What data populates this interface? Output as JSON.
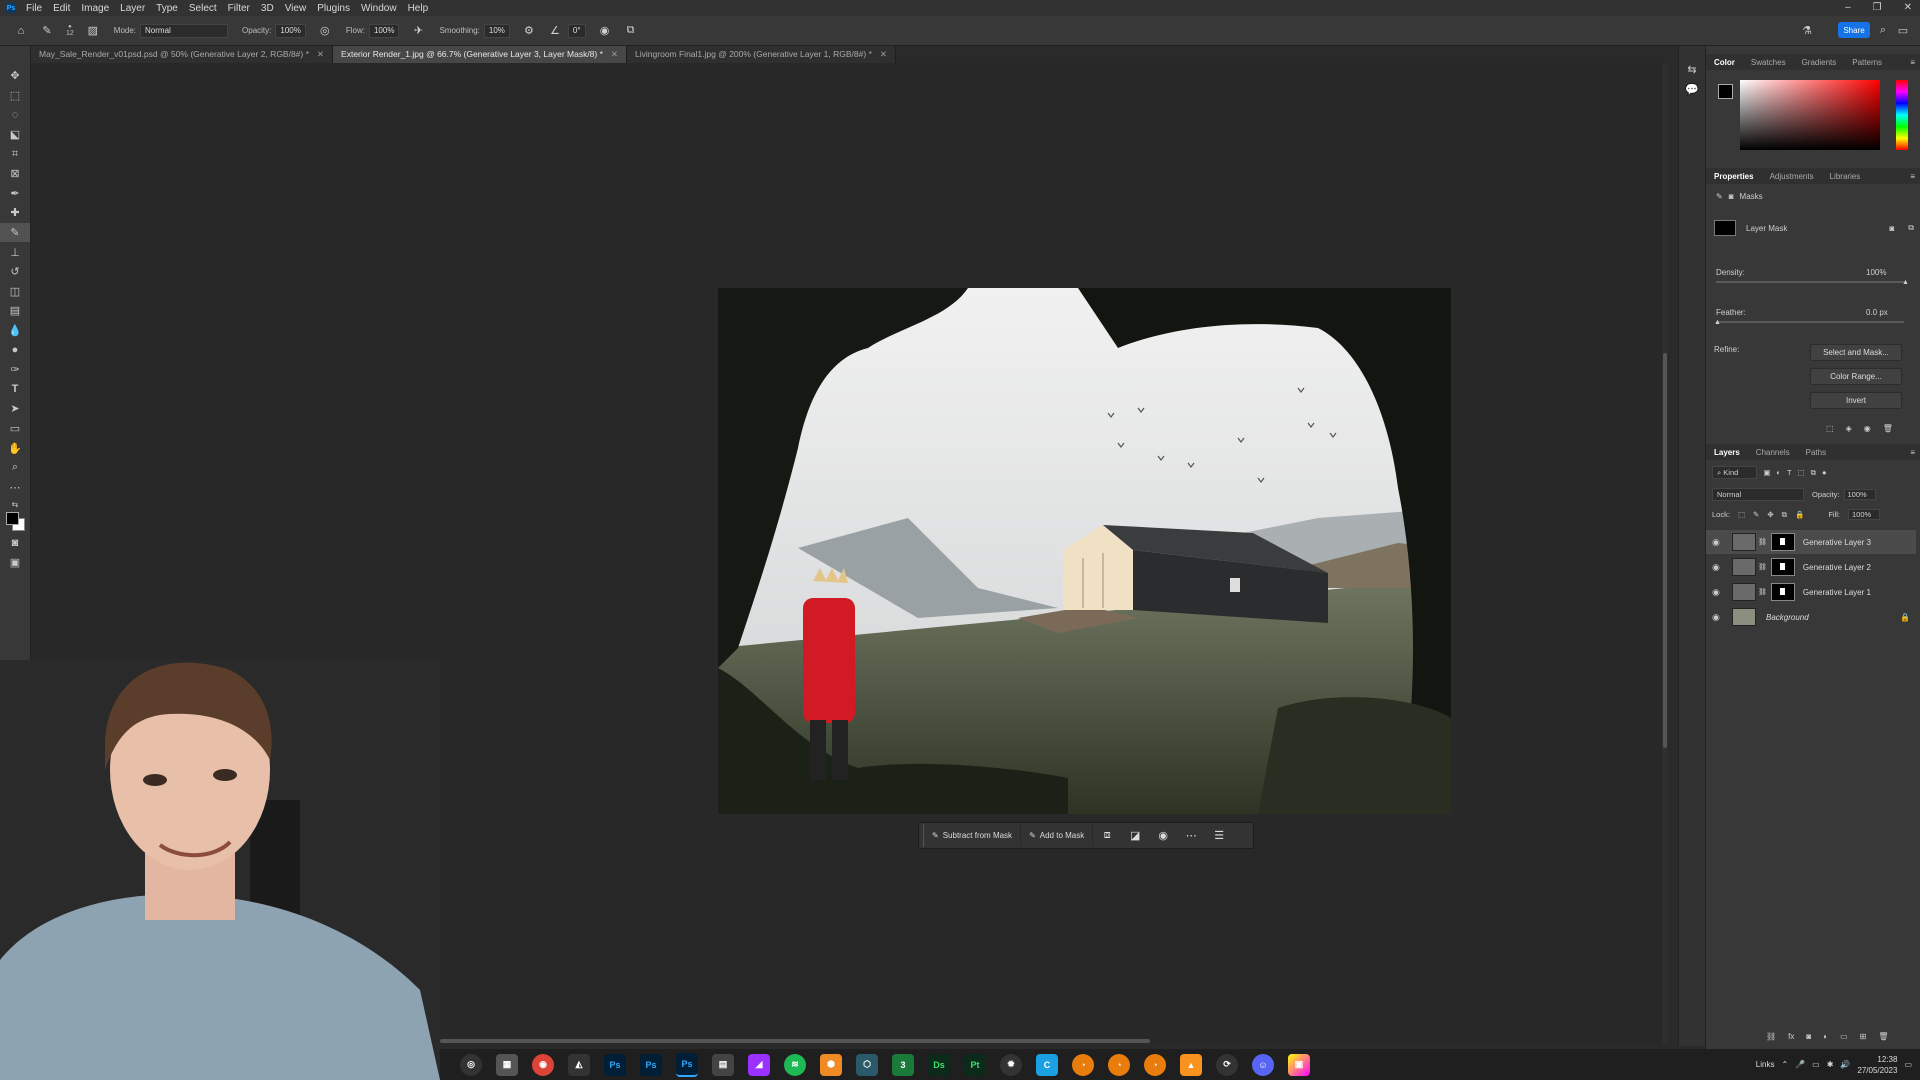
{
  "menubar": {
    "items": [
      "File",
      "Edit",
      "Image",
      "Layer",
      "Type",
      "Select",
      "Filter",
      "3D",
      "View",
      "Plugins",
      "Window",
      "Help"
    ]
  },
  "options": {
    "brush_size": "12",
    "mode_label": "Mode:",
    "mode_value": "Normal",
    "opacity_label": "Opacity:",
    "opacity_value": "100%",
    "flow_label": "Flow:",
    "flow_value": "100%",
    "smoothing_label": "Smoothing:",
    "smoothing_value": "10%",
    "angle_value": "0°",
    "share_label": "Share"
  },
  "tabs": [
    {
      "label": "May_Sale_Render_v01psd.psd @ 50% (Generative Layer 2, RGB/8#) *",
      "active": false
    },
    {
      "label": "Exterior Render_1.jpg @ 66.7% (Generative Layer 3, Layer Mask/8) *",
      "active": true
    },
    {
      "label": "Livingroom Final1.jpg @ 200% (Generative Layer 1, RGB/8#) *",
      "active": false
    }
  ],
  "context_bar": {
    "subtract_label": "Subtract from Mask",
    "add_label": "Add to Mask"
  },
  "color_panel": {
    "tabs": [
      "Color",
      "Swatches",
      "Gradients",
      "Patterns"
    ],
    "foreground": "#000000",
    "background": "#ffffff",
    "hue": "#ff0000"
  },
  "properties": {
    "tabs": [
      "Properties",
      "Adjustments",
      "Libraries"
    ],
    "section_title": "Masks",
    "mask_label": "Layer Mask",
    "density_label": "Density:",
    "density_value": "100%",
    "feather_label": "Feather:",
    "feather_value": "0.0 px",
    "refine_label": "Refine:",
    "select_and_mask": "Select and Mask...",
    "color_range": "Color Range...",
    "invert": "Invert"
  },
  "layers_panel": {
    "tabs": [
      "Layers",
      "Channels",
      "Paths"
    ],
    "kind_label": "Kind",
    "blend_mode": "Normal",
    "opacity_label": "Opacity:",
    "opacity_value": "100%",
    "lock_label": "Lock:",
    "fill_label": "Fill:",
    "fill_value": "100%",
    "layers": [
      {
        "name": "Generative Layer 3",
        "selected": true
      },
      {
        "name": "Generative Layer 2",
        "selected": false
      },
      {
        "name": "Generative Layer 1",
        "selected": false
      },
      {
        "name": "Background",
        "selected": false
      }
    ]
  },
  "taskbar": {
    "tray_links": "Links",
    "time": "12:38",
    "date": "27/05/2023"
  }
}
